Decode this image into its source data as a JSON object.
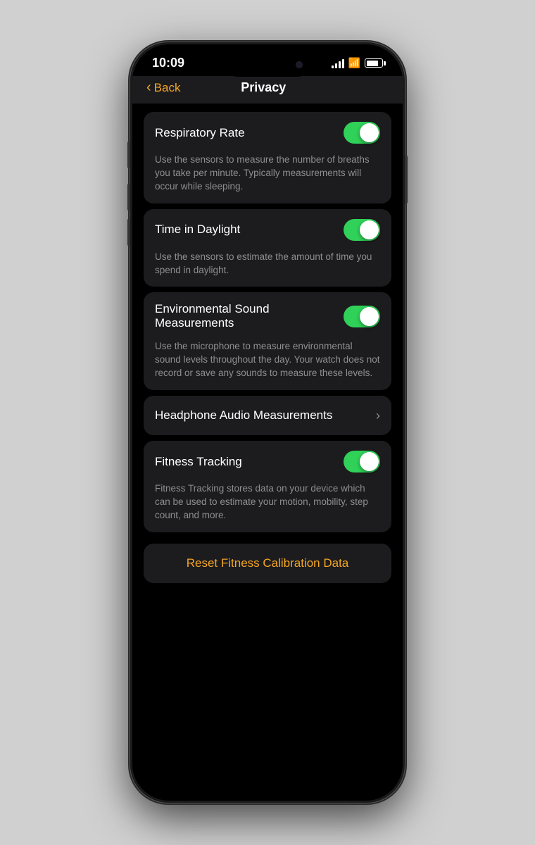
{
  "status_bar": {
    "time": "10:09"
  },
  "nav": {
    "back_label": "Back",
    "title": "Privacy"
  },
  "settings": [
    {
      "id": "respiratory-rate",
      "label": "Respiratory Rate",
      "toggle": true,
      "description": "Use the sensors to measure the number of breaths you take per minute. Typically measurements will occur while sleeping."
    },
    {
      "id": "time-in-daylight",
      "label": "Time in Daylight",
      "toggle": true,
      "description": "Use the sensors to estimate the amount of time you spend in daylight."
    },
    {
      "id": "environmental-sound",
      "label": "Environmental Sound Measurements",
      "toggle": true,
      "description": "Use the microphone to measure environmental sound levels throughout the day. Your watch does not record or save any sounds to measure these levels."
    },
    {
      "id": "headphone-audio",
      "label": "Headphone Audio Measurements",
      "toggle": false,
      "chevron": true,
      "description": ""
    },
    {
      "id": "fitness-tracking",
      "label": "Fitness Tracking",
      "toggle": true,
      "description": "Fitness Tracking stores data on your device which can be used to estimate your motion, mobility, step count, and more."
    }
  ],
  "reset_button": {
    "label": "Reset Fitness Calibration Data"
  },
  "colors": {
    "accent": "#f5a623",
    "toggle_on": "#30d158",
    "toggle_off": "#39393d"
  }
}
